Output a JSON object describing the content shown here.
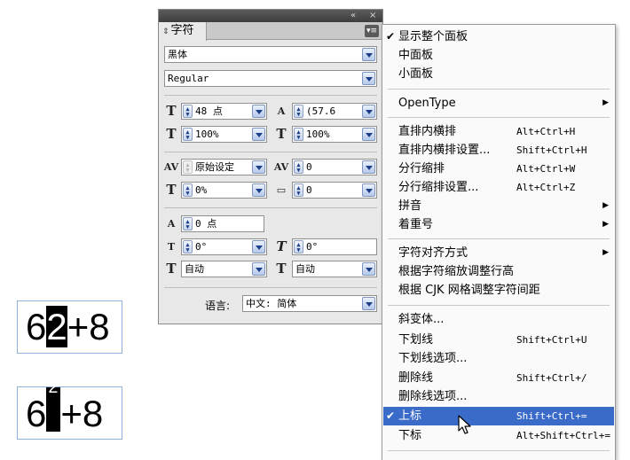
{
  "panel": {
    "tab_label": "字符",
    "tab_arrows": "⇕",
    "collapse_glyph": "«",
    "close_glyph": "×",
    "menu_glyph": "▾≡",
    "font_family": "黑体",
    "font_style": "Regular",
    "size": "48 点",
    "leading": "(57.6",
    "vertical_scale": "100%",
    "horizontal_scale": "100%",
    "kerning": "原始设定",
    "tracking": "0",
    "tsume": "0%",
    "aki": "0",
    "baseline_shift": "0 点",
    "rotation": "0°",
    "skew": "0°",
    "aki_before": "自动",
    "aki_after": "自动",
    "language_label": "语言:",
    "language": "中文: 简体"
  },
  "menu": {
    "items": [
      {
        "label": "显示整个面板",
        "checked": true
      },
      {
        "label": "中面板"
      },
      {
        "label": "小面板"
      },
      {
        "label": "OpenType",
        "submenu": true
      },
      {
        "label": "直排内横排",
        "shortcut": "Alt+Ctrl+H"
      },
      {
        "label": "直排内横排设置...",
        "shortcut": "Shift+Ctrl+H"
      },
      {
        "label": "分行缩排",
        "shortcut": "Alt+Ctrl+W"
      },
      {
        "label": "分行缩排设置...",
        "shortcut": "Alt+Ctrl+Z"
      },
      {
        "label": "拼音",
        "submenu": true
      },
      {
        "label": "着重号",
        "submenu": true
      },
      {
        "label": "字符对齐方式",
        "submenu": true
      },
      {
        "label": "根据字符缩放调整行高"
      },
      {
        "label": "根据 CJK 网格调整字符间距"
      },
      {
        "label": "斜变体..."
      },
      {
        "label": "下划线",
        "shortcut": "Shift+Ctrl+U"
      },
      {
        "label": "下划线选项..."
      },
      {
        "label": "删除线",
        "shortcut": "Shift+Ctrl+/"
      },
      {
        "label": "删除线选项..."
      },
      {
        "label": "上标",
        "shortcut": "Shift+Ctrl+=",
        "checked": true,
        "highlighted": true
      },
      {
        "label": "下标",
        "shortcut": "Alt+Shift+Ctrl+="
      }
    ],
    "check_glyph": "✔",
    "submenu_glyph": "▶"
  },
  "samples": {
    "before": {
      "a": "6",
      "b": "2",
      "c": "+8"
    },
    "after": {
      "a": "6",
      "b": "2",
      "c": "+8"
    }
  },
  "colors": {
    "highlight": "#3a6bc9",
    "sample_border": "#8fb1d9"
  }
}
